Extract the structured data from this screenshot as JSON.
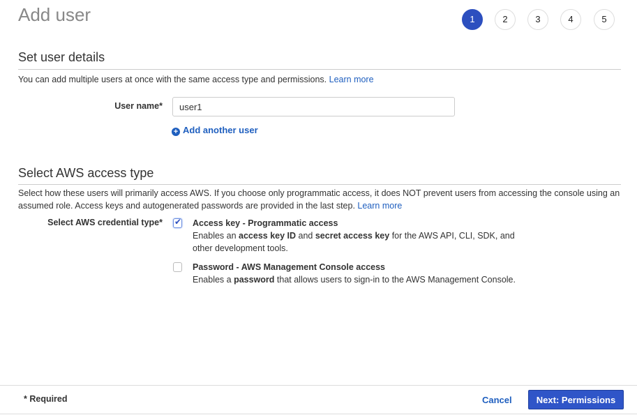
{
  "page_title": "Add user",
  "steps": [
    "1",
    "2",
    "3",
    "4",
    "5"
  ],
  "details": {
    "heading": "Set user details",
    "intro": "You can add multiple users at once with the same access type and permissions.",
    "learn_more": "Learn more",
    "user_name_label": "User name*",
    "user_name_value": "user1",
    "add_another": "Add another user"
  },
  "access": {
    "heading": "Select AWS access type",
    "intro": "Select how these users will primarily access AWS. If you choose only programmatic access, it does NOT prevent users from accessing the console using an assumed role. Access keys and autogenerated passwords are provided in the last step.",
    "learn_more": "Learn more",
    "credential_label": "Select AWS credential type*",
    "options": [
      {
        "title": "Access key - Programmatic access",
        "checked": true,
        "desc": [
          "Enables an ",
          "access key ID",
          " and ",
          "secret access key",
          " for the AWS API, CLI, SDK, and other development tools."
        ]
      },
      {
        "title": "Password - AWS Management Console access",
        "checked": false,
        "desc": [
          "Enables a ",
          "password",
          " that allows users to sign-in to the AWS Management Console."
        ]
      }
    ]
  },
  "footer": {
    "required": "* Required",
    "cancel": "Cancel",
    "next": "Next: Permissions"
  }
}
